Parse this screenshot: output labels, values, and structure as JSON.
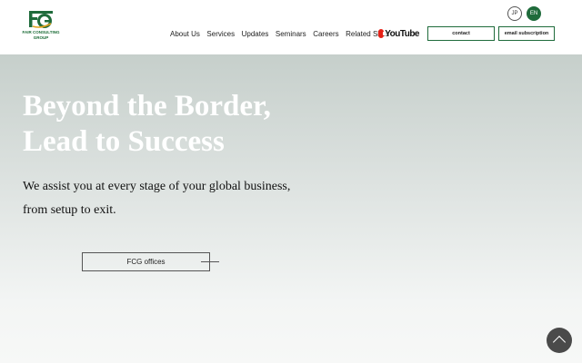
{
  "header": {
    "logo": {
      "mark": "FCG",
      "text_line1": "FAIR CONSULTING",
      "text_line2": "GROUP"
    },
    "languages": [
      "JP",
      "EN"
    ],
    "active_language": "EN",
    "nav": [
      "About Us",
      "Services",
      "Updates",
      "Seminars",
      "Careers",
      "Related Sites"
    ],
    "youtube_label": "YouTube",
    "contact_label": "contact",
    "email_label": "email subscription"
  },
  "hero": {
    "title_line1": "Beyond the Border,",
    "title_line2": "Lead to Success",
    "subtitle_line1": "We assist you at every stage of your global business,",
    "subtitle_line2": "from setup to exit.",
    "offices_label": "FCG offices"
  },
  "colors": {
    "brand_green": "#1f6b3b",
    "youtube_red": "#e62117",
    "scroll_button": "#4a4a4a"
  },
  "icons": {
    "scroll_top": "chevron-up-icon",
    "youtube": "youtube-logo-icon"
  }
}
